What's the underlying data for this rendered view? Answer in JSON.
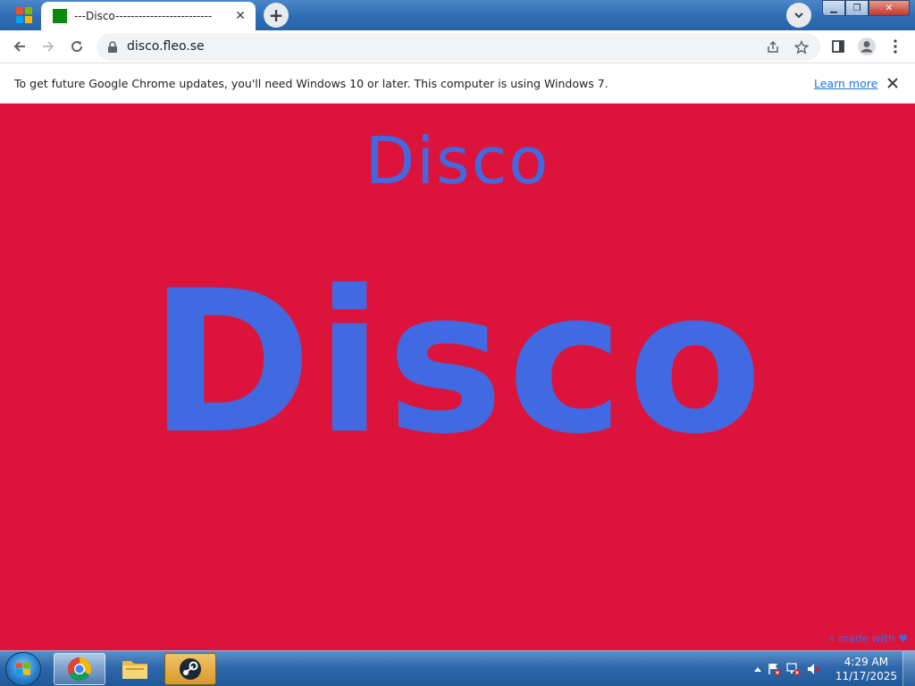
{
  "browser": {
    "tab": {
      "title": "---Disco-------------------------"
    },
    "address_bar": {
      "url": "disco.fleo.se"
    },
    "infobar": {
      "message": "To get future Google Chrome updates, you'll need Windows 10 or later. This computer is using Windows 7.",
      "link_label": "Learn more"
    }
  },
  "page": {
    "heading_small": "Disco",
    "heading_big": "Disco",
    "footer_text": "« made with ♥",
    "colors": {
      "background": "#dc143c",
      "text": "#4169e1"
    }
  },
  "taskbar": {
    "apps": [
      "chrome-icon",
      "file-explorer-icon",
      "steam-icon"
    ],
    "clock": {
      "time": "4:29 AM",
      "date": "11/17/2025"
    }
  }
}
